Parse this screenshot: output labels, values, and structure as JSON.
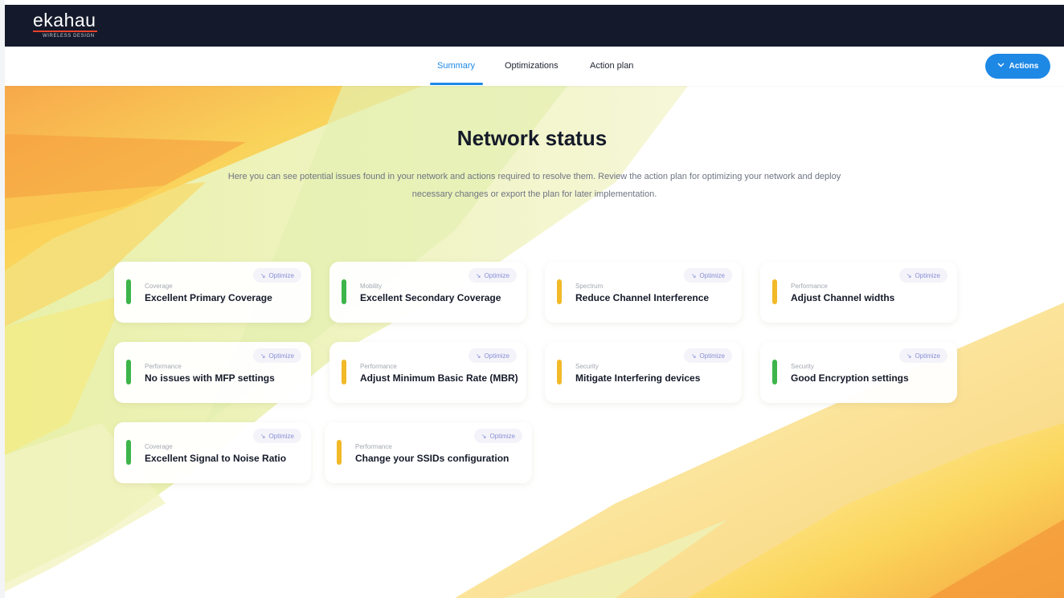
{
  "header": {
    "logo_text": "ekahau",
    "logo_sub": "WIRELESS DESIGN"
  },
  "tabs": [
    {
      "label": "Summary",
      "active": true
    },
    {
      "label": "Optimizations",
      "active": false
    },
    {
      "label": "Action plan",
      "active": false
    }
  ],
  "actions_button": {
    "label": "Actions",
    "icon": "chevron-down-icon"
  },
  "main": {
    "title": "Network status",
    "description": "Here you can see potential issues found in your network and actions required to resolve them. Review the action plan for optimizing your network and deploy necessary changes or export the plan for later implementation."
  },
  "cards": [
    {
      "category": "Coverage",
      "name": "Excellent Primary Coverage",
      "status": "green",
      "optimize_label": "Optimize"
    },
    {
      "category": "Mobility",
      "name": "Excellent Secondary Coverage",
      "status": "green",
      "optimize_label": "Optimize"
    },
    {
      "category": "Spectrum",
      "name": "Reduce Channel Interference",
      "status": "yellow",
      "optimize_label": "Optimize"
    },
    {
      "category": "Performance",
      "name": "Adjust Channel widths",
      "status": "yellow",
      "optimize_label": "Optimize"
    },
    {
      "category": "Performance",
      "name": "No issues with MFP settings",
      "status": "green",
      "optimize_label": "Optimize"
    },
    {
      "category": "Performance",
      "name": "Adjust Minimum Basic Rate (MBR)",
      "status": "yellow",
      "optimize_label": "Optimize"
    },
    {
      "category": "Security",
      "name": "Mitigate Interfering devices",
      "status": "yellow",
      "optimize_label": "Optimize"
    },
    {
      "category": "Security",
      "name": "Good Encryption settings",
      "status": "green",
      "optimize_label": "Optimize"
    },
    {
      "category": "Coverage",
      "name": "Excellent Signal to Noise Ratio",
      "status": "green",
      "optimize_label": "Optimize"
    },
    {
      "category": "Performance",
      "name": "Change your SSIDs configuration",
      "status": "yellow",
      "optimize_label": "Optimize"
    }
  ],
  "colors": {
    "accent": "#1e88e5",
    "header_bg": "#141a2b",
    "status_green": "#3db54a",
    "status_yellow": "#f2b928",
    "logo_line": "#e8412c"
  }
}
